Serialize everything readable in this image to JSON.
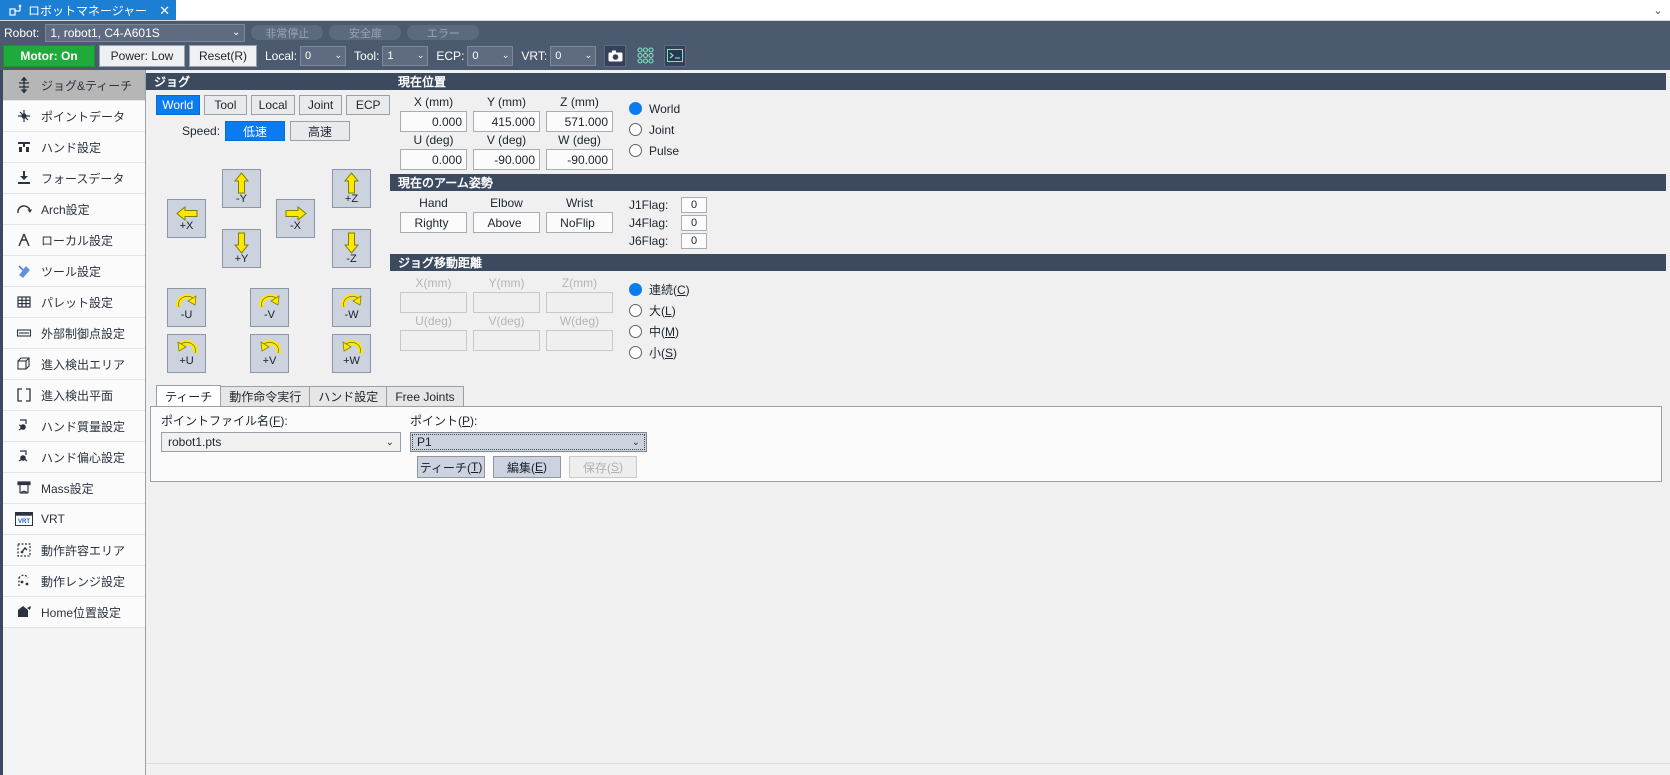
{
  "window": {
    "tab_title": "ロボットマネージャー",
    "tab_close": "✕",
    "collapse_caret": "⌄"
  },
  "robotbar": {
    "label": "Robot:",
    "selected_robot": "1, robot1, C4-A601S",
    "caret": "⌄",
    "status_pills": [
      "非常停止",
      "安全扉",
      "エラー"
    ]
  },
  "controlbar": {
    "motor": "Motor: On",
    "power": "Power: Low",
    "reset": "Reset(R)",
    "selectors": [
      {
        "label": "Local:",
        "value": "0"
      },
      {
        "label": "Tool:",
        "value": "1"
      },
      {
        "label": "ECP:",
        "value": "0"
      },
      {
        "label": "VRT:",
        "value": "0"
      }
    ],
    "icons": [
      "camera-icon",
      "grid-dots-icon",
      "terminal-icon"
    ]
  },
  "sidebar": {
    "items": [
      {
        "label": "ジョグ&ティーチ",
        "icon": "jog-teach-icon",
        "active": true
      },
      {
        "label": "ポイントデータ",
        "icon": "point-data-icon",
        "active": false
      },
      {
        "label": "ハンド設定",
        "icon": "hand-settings-icon",
        "active": false
      },
      {
        "label": "フォースデータ",
        "icon": "force-data-icon",
        "active": false
      },
      {
        "label": "Arch設定",
        "icon": "arch-settings-icon",
        "active": false
      },
      {
        "label": "ローカル設定",
        "icon": "local-settings-icon",
        "active": false
      },
      {
        "label": "ツール設定",
        "icon": "tool-settings-icon",
        "active": false
      },
      {
        "label": "パレット設定",
        "icon": "pallet-settings-icon",
        "active": false
      },
      {
        "label": "外部制御点設定",
        "icon": "ecp-settings-icon",
        "active": false
      },
      {
        "label": "進入検出エリア",
        "icon": "entry-area-icon",
        "active": false
      },
      {
        "label": "進入検出平面",
        "icon": "entry-plane-icon",
        "active": false
      },
      {
        "label": "ハンド質量設定",
        "icon": "hand-weight-icon",
        "active": false
      },
      {
        "label": "ハンド偏心設定",
        "icon": "hand-offset-icon",
        "active": false
      },
      {
        "label": "Mass設定",
        "icon": "mass-settings-icon",
        "active": false
      },
      {
        "label": "VRT",
        "icon": "vrt-icon",
        "active": false
      },
      {
        "label": "動作許容エリア",
        "icon": "motion-area-icon",
        "active": false
      },
      {
        "label": "動作レンジ設定",
        "icon": "motion-range-icon",
        "active": false
      },
      {
        "label": "Home位置設定",
        "icon": "home-position-icon",
        "active": false
      }
    ]
  },
  "jog": {
    "header": "ジョグ",
    "modes": [
      {
        "label": "World",
        "selected": true
      },
      {
        "label": "Tool",
        "selected": false
      },
      {
        "label": "Local",
        "selected": false
      },
      {
        "label": "Joint",
        "selected": false
      },
      {
        "label": "ECP",
        "selected": false
      }
    ],
    "speed_label": "Speed:",
    "speeds": [
      {
        "label": "低速",
        "selected": true
      },
      {
        "label": "高速",
        "selected": false
      }
    ],
    "buttons": {
      "plus_x": "+X",
      "minus_x": "-X",
      "plus_y": "+Y",
      "minus_y": "-Y",
      "plus_z": "+Z",
      "minus_z": "-Z",
      "minus_u": "-U",
      "plus_u": "+U",
      "minus_v": "-V",
      "plus_v": "+V",
      "minus_w": "-W",
      "plus_w": "+W"
    }
  },
  "current_position": {
    "header": "現在位置",
    "fields": [
      {
        "label": "X (mm)",
        "value": "0.000"
      },
      {
        "label": "Y (mm)",
        "value": "415.000"
      },
      {
        "label": "Z (mm)",
        "value": "571.000"
      },
      {
        "label": "U (deg)",
        "value": "0.000"
      },
      {
        "label": "V (deg)",
        "value": "-90.000"
      },
      {
        "label": "W (deg)",
        "value": "-90.000"
      }
    ],
    "coord_modes": [
      {
        "label": "World",
        "accesskey": "W",
        "selected": true
      },
      {
        "label": "Joint",
        "accesskey": "J",
        "selected": false
      },
      {
        "label": "Pulse",
        "accesskey": "u",
        "selected": false
      }
    ]
  },
  "arm_pose": {
    "header": "現在のアーム姿勢",
    "fields": [
      {
        "label": "Hand",
        "value": "Righty"
      },
      {
        "label": "Elbow",
        "value": "Above"
      },
      {
        "label": "Wrist",
        "value": "NoFlip"
      }
    ],
    "flags": [
      {
        "label": "J1Flag:",
        "value": "0"
      },
      {
        "label": "J4Flag:",
        "value": "0"
      },
      {
        "label": "J6Flag:",
        "value": "0"
      }
    ]
  },
  "jog_distance": {
    "header": "ジョグ移動距離",
    "fields": [
      {
        "label": "X(mm)",
        "value": ""
      },
      {
        "label": "Y(mm)",
        "value": ""
      },
      {
        "label": "Z(mm)",
        "value": ""
      },
      {
        "label": "U(deg)",
        "value": ""
      },
      {
        "label": "V(deg)",
        "value": ""
      },
      {
        "label": "W(deg)",
        "value": ""
      }
    ],
    "modes": [
      {
        "label": "連続(",
        "accesskey": "C",
        "suffix": ")",
        "selected": true
      },
      {
        "label": "大(",
        "accesskey": "L",
        "suffix": ")",
        "selected": false
      },
      {
        "label": "中(",
        "accesskey": "M",
        "suffix": ")",
        "selected": false
      },
      {
        "label": "小(",
        "accesskey": "S",
        "suffix": ")",
        "selected": false
      }
    ]
  },
  "teach_section": {
    "tabs": [
      {
        "label": "ティーチ",
        "selected": true
      },
      {
        "label": "動作命令実行",
        "selected": false
      },
      {
        "label": "ハンド設定",
        "selected": false
      },
      {
        "label": "Free Joints",
        "selected": false
      }
    ],
    "point_file_label": "ポイントファイル名(",
    "point_file_key": "F",
    "point_file_suffix": "):",
    "point_file_value": "robot1.pts",
    "point_label": "ポイント(",
    "point_key": "P",
    "point_suffix": "):",
    "point_value": "P1",
    "buttons": [
      {
        "label": "ティーチ(",
        "key": "T",
        "suffix": ")",
        "disabled": false
      },
      {
        "label": "編集(",
        "key": "E",
        "suffix": ")",
        "disabled": false
      },
      {
        "label": "保存(",
        "key": "S",
        "suffix": ")",
        "disabled": true
      }
    ],
    "caret": "⌄"
  },
  "colors": {
    "accent_blue": "#0a7cf0",
    "header_navy": "#3c4a60",
    "bar_slate": "#4c5a70",
    "motor_green": "#1faa3c",
    "arrow_yellow": "#ffe800"
  }
}
